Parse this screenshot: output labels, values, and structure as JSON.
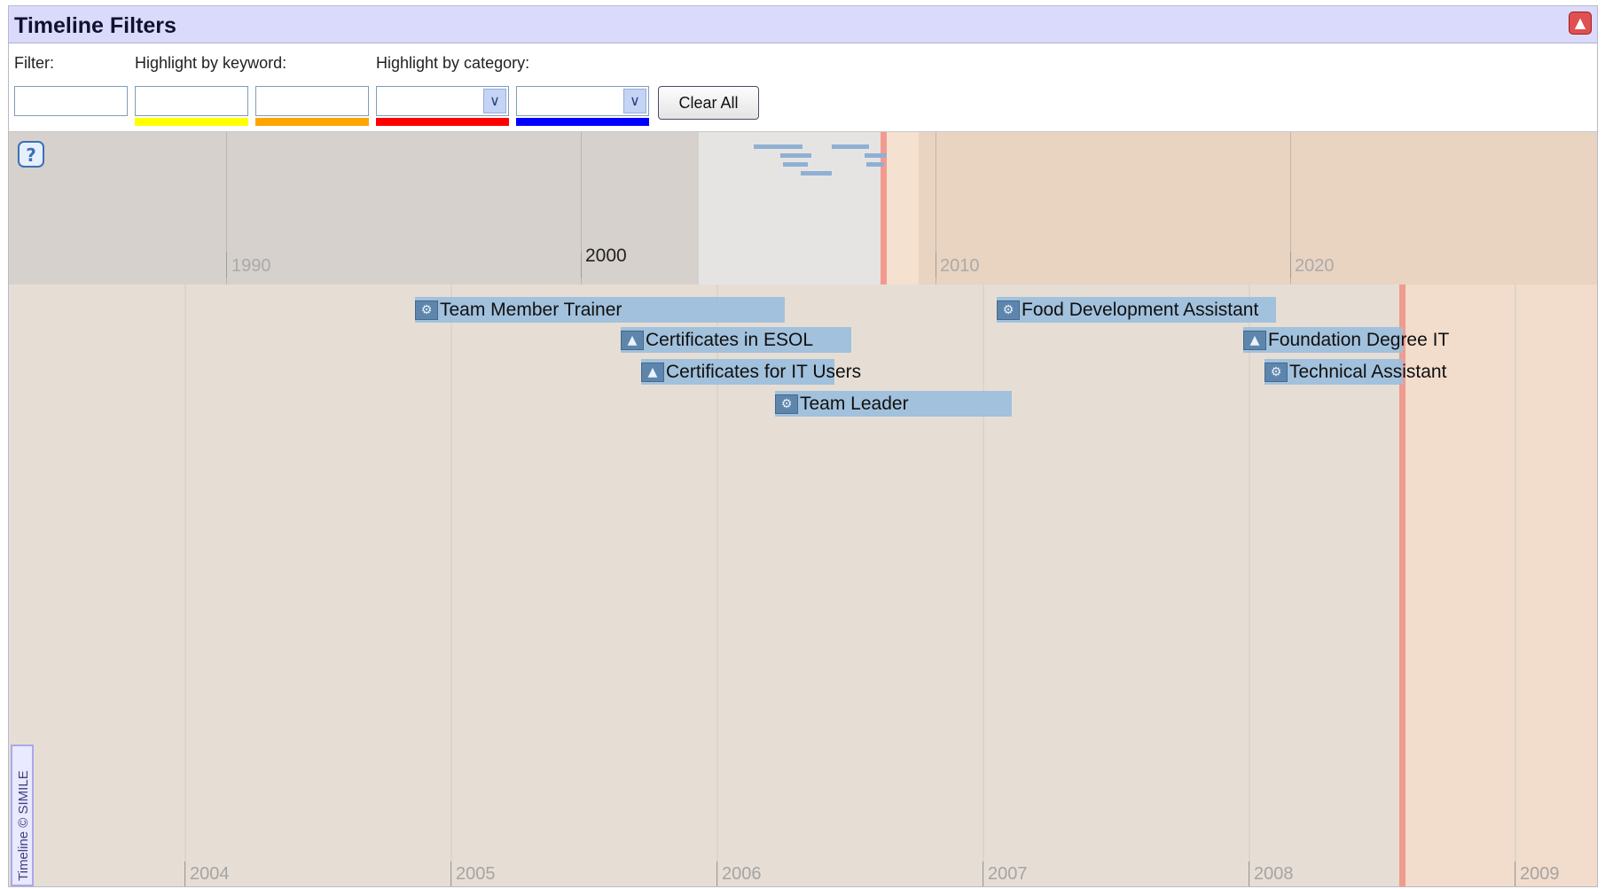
{
  "header": {
    "title": "Timeline Filters",
    "collapse_icon": "caret-up-icon"
  },
  "filters": {
    "filter_label": "Filter:",
    "keyword_label": "Highlight by keyword:",
    "category_label": "Highlight by category:",
    "filter_value": "",
    "keyword1_value": "",
    "keyword2_value": "",
    "category1_value": "",
    "category2_value": "",
    "clear_label": "Clear All",
    "keyword1_color": "#ffff00",
    "keyword2_color": "#ffa500",
    "category1_color": "#ff0000",
    "category2_color": "#0000ff"
  },
  "overview": {
    "help_icon": "help-bubble-icon",
    "years": [
      "1990",
      "2000",
      "2010",
      "2020"
    ]
  },
  "detail": {
    "years": [
      "2004",
      "2005",
      "2006",
      "2007",
      "2008",
      "2009"
    ],
    "events": [
      {
        "label": "Team Member Trainer",
        "icon": "gear-icon"
      },
      {
        "label": "Certificates in ESOL",
        "icon": "graduation-cap-icon"
      },
      {
        "label": "Certificates for IT Users",
        "icon": "graduation-cap-icon"
      },
      {
        "label": "Team Leader",
        "icon": "gear-icon"
      },
      {
        "label": "Food Development Assistant",
        "icon": "gear-icon"
      },
      {
        "label": "Foundation Degree IT",
        "icon": "graduation-cap-icon"
      },
      {
        "label": "Technical Assistant",
        "icon": "gear-icon"
      }
    ],
    "credit": "Timeline © SIMILE"
  }
}
